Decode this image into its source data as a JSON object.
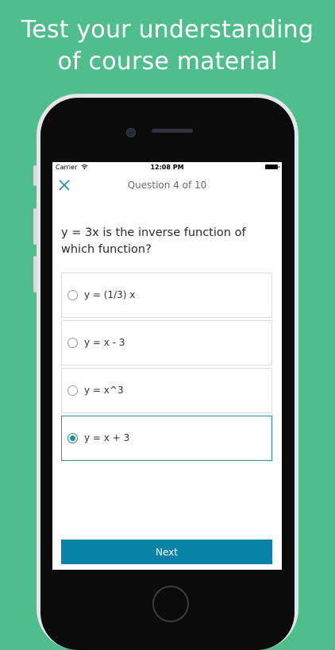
{
  "headline": {
    "line1": "Test your understanding",
    "line2": "of course material"
  },
  "status_bar": {
    "carrier": "Carrier",
    "time": "12:08 PM"
  },
  "nav": {
    "title": "Question 4 of 10"
  },
  "question": {
    "text": "y = 3x is the inverse function of which function?"
  },
  "options": [
    {
      "label": "y = (1/3) x",
      "selected": false
    },
    {
      "label": "y = x - 3",
      "selected": false
    },
    {
      "label": "y = x^3",
      "selected": false
    },
    {
      "label": "y = x + 3",
      "selected": true
    }
  ],
  "footer": {
    "next_label": "Next"
  },
  "colors": {
    "background": "#4fbe8c",
    "accent": "#0a82a8",
    "selected_border": "#2a8fb0"
  }
}
